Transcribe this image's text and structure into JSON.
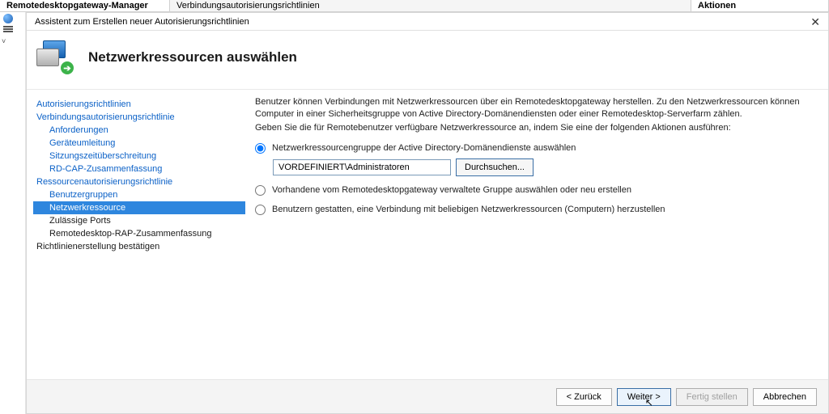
{
  "topbar": {
    "manager": "Remotedesktopgateway-Manager",
    "policies": "Verbindungsautorisierungsrichtlinien",
    "actions": "Aktionen"
  },
  "wizard": {
    "title": "Assistent zum Erstellen neuer Autorisierungsrichtlinien",
    "heading": "Netzwerkressourcen auswählen"
  },
  "nav": {
    "authpolicies": "Autorisierungsrichtlinien",
    "cap": "Verbindungsautorisierungsrichtlinie",
    "cap_req": "Anforderungen",
    "cap_dev": "Geräteumleitung",
    "cap_timeout": "Sitzungszeitüberschreitung",
    "cap_sum": "RD-CAP-Zusammenfassung",
    "rap": "Ressourcenautorisierungsrichtlinie",
    "rap_users": "Benutzergruppen",
    "rap_net": "Netzwerkressource",
    "rap_ports": "Zulässige Ports",
    "rap_sum": "Remotedesktop-RAP-Zusammenfassung",
    "confirm": "Richtlinienerstellung bestätigen"
  },
  "content": {
    "intro1": "Benutzer können Verbindungen mit Netzwerkressourcen über ein Remotedesktopgateway herstellen. Zu den Netzwerkressourcen können Computer in einer Sicherheitsgruppe von Active Directory-Domänendiensten oder einer Remotedesktop-Serverfarm zählen.",
    "intro2": "Geben Sie die für Remotebenutzer verfügbare Netzwerkressource an, indem Sie eine der folgenden Aktionen ausführen:",
    "opt1": "Netzwerkressourcengruppe der Active Directory-Domänendienste auswählen",
    "opt2": "Vorhandene vom Remotedesktopgateway verwaltete Gruppe auswählen oder neu erstellen",
    "opt3": "Benutzern gestatten, eine Verbindung mit beliebigen Netzwerkressourcen (Computern) herzustellen",
    "group_value": "VORDEFINIERT\\Administratoren",
    "browse": "Durchsuchen..."
  },
  "buttons": {
    "back": "< Zurück",
    "next": "Weiter >",
    "finish": "Fertig stellen",
    "cancel": "Abbrechen"
  }
}
